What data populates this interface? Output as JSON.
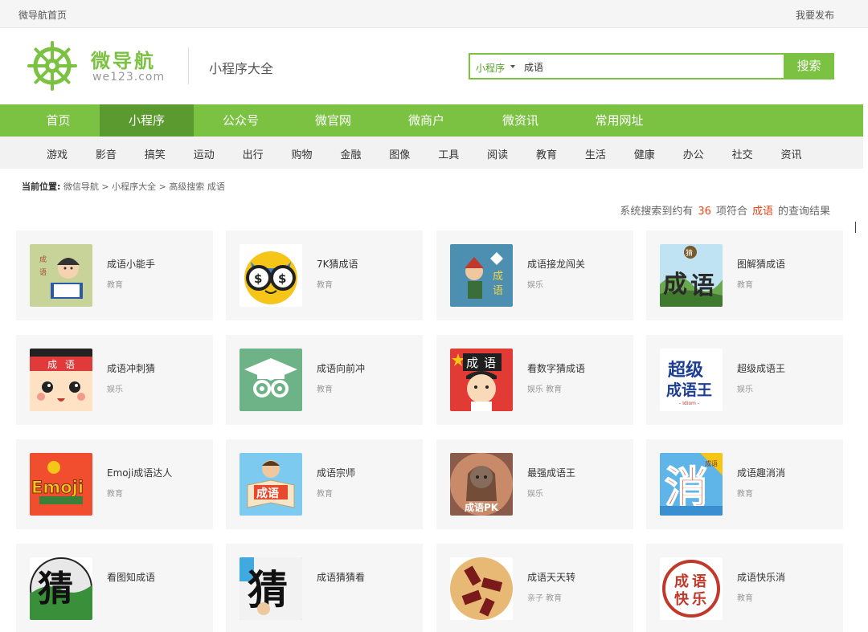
{
  "topbar": {
    "home": "微导航首页",
    "publish": "我要发布"
  },
  "header": {
    "logo_title": "微导航",
    "logo_domain": "we123.com",
    "subtitle": "小程序大全"
  },
  "search": {
    "type": "小程序",
    "value": "成语",
    "button": "搜索"
  },
  "mainnav": [
    "首页",
    "小程序",
    "公众号",
    "微官网",
    "微商户",
    "微资讯",
    "常用网址"
  ],
  "mainnav_active": "小程序",
  "subnav": [
    "游戏",
    "影音",
    "搞笑",
    "运动",
    "出行",
    "购物",
    "金融",
    "图像",
    "工具",
    "阅读",
    "教育",
    "生活",
    "健康",
    "办公",
    "社交",
    "资讯"
  ],
  "breadcrumb": {
    "label": "当前位置:",
    "path": "微信导航 > 小程序大全 > 高级搜索 成语"
  },
  "result": {
    "prefix": "系统搜索到约有",
    "count": "36",
    "middle": "项符合",
    "keyword": "成语",
    "suffix": "的查询结果"
  },
  "apps": [
    {
      "name": "成语小能手",
      "category": "教育",
      "icon": "reading-kid-icon"
    },
    {
      "name": "7K猜成语",
      "category": "教育",
      "icon": "money-owl-icon"
    },
    {
      "name": "成语接龙闯关",
      "category": "娱乐",
      "icon": "warrior-icon"
    },
    {
      "name": "图解猜成语",
      "category": "教育",
      "icon": "landscape-chars-icon"
    },
    {
      "name": "成语冲刺猜",
      "category": "娱乐",
      "icon": "headband-face-icon"
    },
    {
      "name": "成语向前冲",
      "category": "教育",
      "icon": "graduation-cap-icon"
    },
    {
      "name": "看数字猜成语",
      "category": "娱乐 教育",
      "icon": "boy-sign-icon"
    },
    {
      "name": "超级成语王",
      "category": "娱乐",
      "icon": "super-idiom-text-icon"
    },
    {
      "name": "Emoji成语达人",
      "category": "教育",
      "icon": "emoji-text-icon"
    },
    {
      "name": "成语宗师",
      "category": "教育",
      "icon": "book-boy-icon"
    },
    {
      "name": "最强成语王",
      "category": "娱乐",
      "icon": "girl-pk-icon"
    },
    {
      "name": "成语趣消消",
      "category": "教育",
      "icon": "xiao-char-icon"
    },
    {
      "name": "看图知成语",
      "category": "",
      "icon": "cai-brush-icon"
    },
    {
      "name": "成语猜猜看",
      "category": "",
      "icon": "cai-calligraphy-icon"
    },
    {
      "name": "成语天天转",
      "category": "亲子 教育",
      "icon": "spinning-blocks-icon"
    },
    {
      "name": "成语快乐消",
      "category": "教育",
      "icon": "red-seal-icon"
    }
  ],
  "icon_texts": {
    "chengyu_v": "成语",
    "cheng": "成",
    "yu": "语",
    "chao_ji": "超级",
    "cheng_yu_wang": "成语王",
    "idiom": "- Idiom -",
    "emoji": "Emoji",
    "xiao": "消",
    "cai": "猜",
    "pk": "成语PK",
    "kuai": "快",
    "le": "乐"
  },
  "colors": {
    "brand_green": "#7bc142",
    "nav_active": "#5a9a2f",
    "highlight": "#e8471b"
  }
}
